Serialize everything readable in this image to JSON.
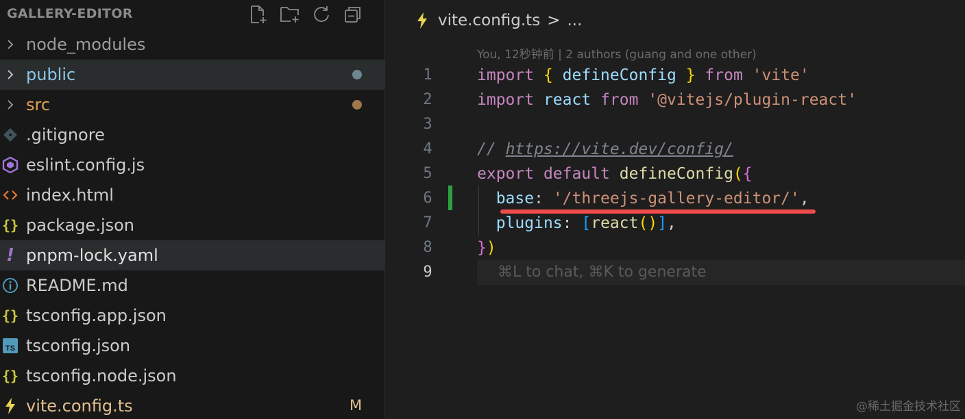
{
  "explorer": {
    "title": "GALLERY-EDITOR",
    "actions": [
      {
        "name": "new-file-icon"
      },
      {
        "name": "new-folder-icon"
      },
      {
        "name": "refresh-icon"
      },
      {
        "name": "collapse-all-icon"
      }
    ],
    "items": [
      {
        "label": "node_modules",
        "kind": "folder"
      },
      {
        "label": "public",
        "kind": "folder",
        "status": "dot"
      },
      {
        "label": "src",
        "kind": "folder",
        "status": "dot"
      },
      {
        "label": ".gitignore",
        "kind": "file",
        "icon": "git-icon"
      },
      {
        "label": "eslint.config.js",
        "kind": "file",
        "icon": "eslint-icon"
      },
      {
        "label": "index.html",
        "kind": "file",
        "icon": "html-icon"
      },
      {
        "label": "package.json",
        "kind": "file",
        "icon": "json-icon"
      },
      {
        "label": "pnpm-lock.yaml",
        "kind": "file",
        "icon": "yaml-icon"
      },
      {
        "label": "README.md",
        "kind": "file",
        "icon": "info-icon"
      },
      {
        "label": "tsconfig.app.json",
        "kind": "file",
        "icon": "json-icon"
      },
      {
        "label": "tsconfig.json",
        "kind": "file",
        "icon": "typescript-icon"
      },
      {
        "label": "tsconfig.node.json",
        "kind": "file",
        "icon": "json-icon"
      },
      {
        "label": "vite.config.ts",
        "kind": "file",
        "icon": "vite-icon",
        "badge": "M"
      }
    ]
  },
  "editor": {
    "breadcrumb": {
      "file": "vite.config.ts",
      "separator": ">",
      "more": "..."
    },
    "blame": "You, 12秒钟前 | 2 authors (guang and one other)",
    "line_numbers": [
      "1",
      "2",
      "3",
      "4",
      "5",
      "6",
      "7",
      "8",
      "9"
    ],
    "code": {
      "l1": {
        "import": "import",
        "ob": "{",
        "name": "defineConfig",
        "cb": "}",
        "from": "from",
        "str": "'vite'"
      },
      "l2": {
        "import": "import",
        "name": "react",
        "from": "from",
        "str": "'@vitejs/plugin-react'"
      },
      "l4": {
        "slashes": "//",
        "url": "https://vite.dev/config/"
      },
      "l5": {
        "export": "export",
        "default": "default",
        "fn": "defineConfig",
        "paren": "(",
        "brace": "{"
      },
      "l6": {
        "key": "base",
        "colon": ":",
        "str": "'/threejs-gallery-editor/'",
        "comma": ","
      },
      "l7": {
        "key": "plugins",
        "colon": ":",
        "ob": "[",
        "fn": "react",
        "parens_open": "(",
        "parens_close": ")",
        "cb": "]",
        "comma": ","
      },
      "l8": {
        "brace": "}",
        "paren": ")"
      }
    },
    "hint": "⌘L to chat, ⌘K to generate"
  },
  "watermark": "@稀土掘金技术社区",
  "colors": {
    "added_gutter": "#2ea043",
    "underline": "#f14c4c",
    "modified": "#e2c08d"
  }
}
